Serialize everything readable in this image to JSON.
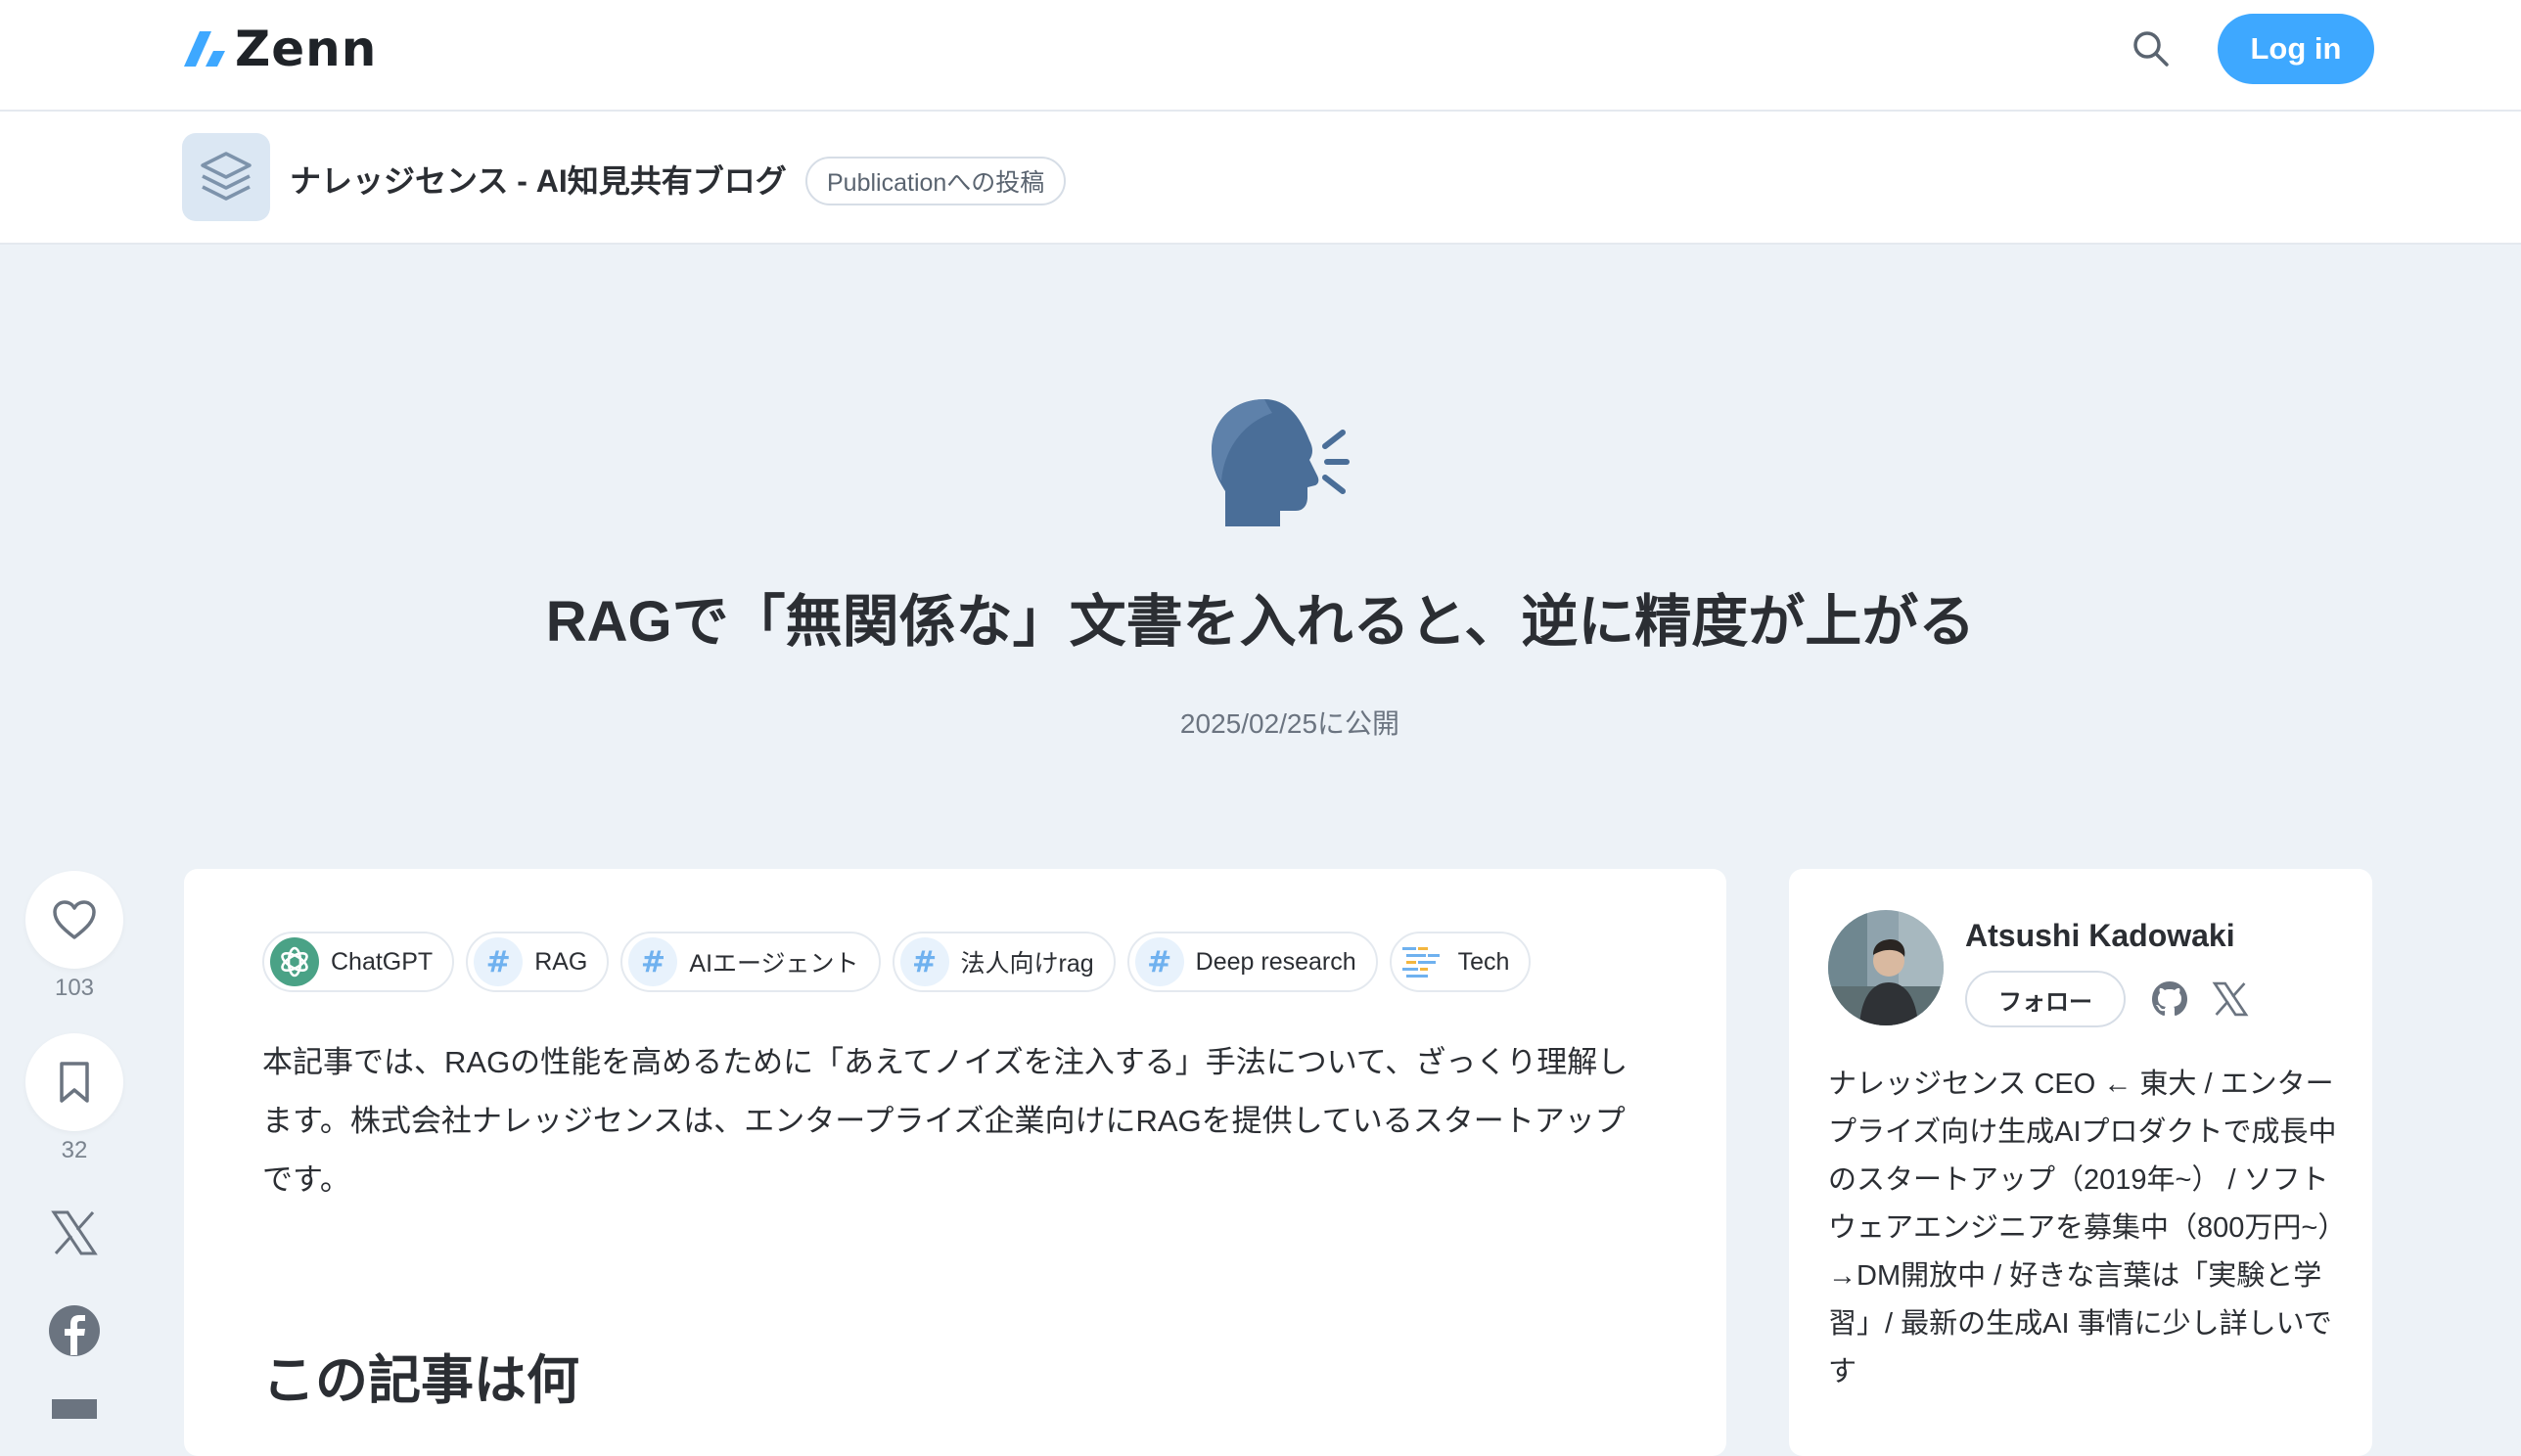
{
  "header": {
    "logo_text": "Zenn",
    "login_label": "Log in",
    "icons": {
      "logo": "zenn-logo-icon",
      "search": "search-icon"
    }
  },
  "publication": {
    "name": "ナレッジセンス - AI知見共有ブログ",
    "badge": "Publicationへの投稿",
    "avatar_icon": "stacked-layers-icon"
  },
  "article": {
    "emoji": "speaking-head-icon",
    "title": "RAGで「無関係な」文書を入れると、逆に精度が上がる",
    "published": "2025/02/25に公開",
    "tags": [
      {
        "label": "ChatGPT",
        "icon": "chatgpt-icon"
      },
      {
        "label": "RAG",
        "icon": "hash-icon"
      },
      {
        "label": "AIエージェント",
        "icon": "hash-icon"
      },
      {
        "label": "法人向けrag",
        "icon": "hash-icon"
      },
      {
        "label": "Deep research",
        "icon": "hash-icon"
      },
      {
        "label": "Tech",
        "icon": "tech-icon"
      }
    ],
    "lead": "本記事では、RAGの性能を高めるために「あえてノイズを注入する」手法について、ざっくり理解します。株式会社ナレッジセンスは、エンタープライズ企業向けにRAGを提供しているスタートアップです。",
    "section_heading": "この記事は何"
  },
  "actions": {
    "likes": "103",
    "bookmarks": "32",
    "icons": [
      "heart-icon",
      "bookmark-icon",
      "x-icon",
      "facebook-icon",
      "hatena-icon"
    ]
  },
  "author": {
    "name": "Atsushi Kadowaki",
    "follow_label": "フォロー",
    "bio": "ナレッジセンス CEO ← 東大 / エンタープライズ向け生成AIプロダクトで成長中のスタートアップ（2019年~） / ソフトウェアエンジニアを募集中（800万円~）→DM開放中 / 好きな言葉は「実験と学習」/ 最新の生成AI 事情に少し詳しいです",
    "social_icons": [
      "github-icon",
      "x-icon"
    ]
  },
  "colors": {
    "accent": "#3ea8ff",
    "background": "#edf2f7",
    "tag_icon": "#6fb1ef"
  }
}
